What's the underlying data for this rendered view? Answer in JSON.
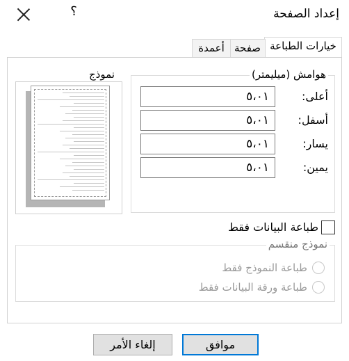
{
  "dialog": {
    "title": "إعداد الصفحة",
    "help": "؟"
  },
  "tabs": [
    {
      "label": "خيارات الطباعة"
    },
    {
      "label": "صفحة"
    },
    {
      "label": "أعمدة"
    }
  ],
  "margins": {
    "group_title": "هوامش (ميليمتر)",
    "top_label": "أعلى:",
    "top_value": "٥،٠١",
    "bottom_label": "أسفل:",
    "bottom_value": "٥،٠١",
    "left_label": "يسار:",
    "left_value": "٥،٠١",
    "right_label": "يمين:",
    "right_value": "٥،٠١"
  },
  "preview": {
    "title": "نموذج"
  },
  "print_data_only": {
    "label": "طباعة البيانات فقط",
    "checked": false
  },
  "split_form": {
    "group_title": "نموذج منقسم",
    "option1": "طباعة النموذج فقط",
    "option2": "طباعة ورقة البيانات فقط"
  },
  "buttons": {
    "ok": "موافق",
    "cancel": "إلغاء الأمر"
  }
}
